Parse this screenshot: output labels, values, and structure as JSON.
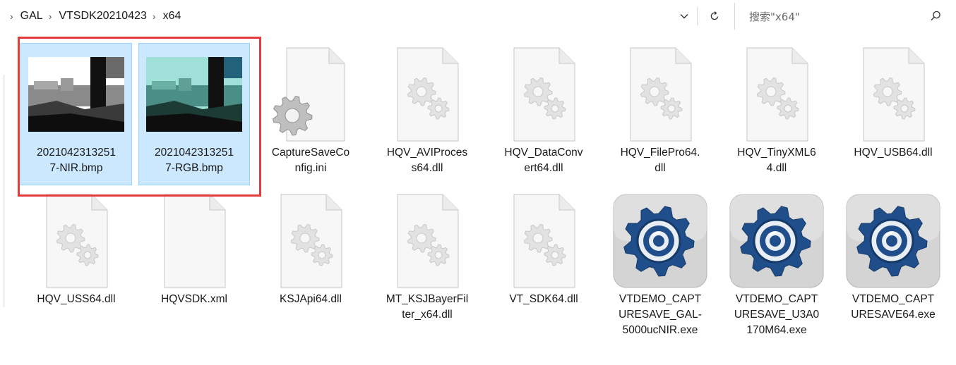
{
  "breadcrumb": {
    "items": [
      "GAL",
      "VTSDK20210423",
      "x64"
    ],
    "separator": "›"
  },
  "toolbar": {
    "dropdown_icon": "chevron-down-icon",
    "refresh_icon": "refresh-icon"
  },
  "search": {
    "placeholder": "搜索\"x64\"",
    "icon": "search-icon"
  },
  "files": [
    {
      "name": "20210423132517-NIR.bmp",
      "line1": "2021042313251",
      "line2": "7-NIR.bmp",
      "type": "bmp-nir",
      "selected": true
    },
    {
      "name": "20210423132517-RGB.bmp",
      "line1": "2021042313251",
      "line2": "7-RGB.bmp",
      "type": "bmp-rgb",
      "selected": true
    },
    {
      "name": "CaptureSaveConfig.ini",
      "line1": "CaptureSaveCo",
      "line2": "nfig.ini",
      "type": "ini"
    },
    {
      "name": "HQV_AVIProcess64.dll",
      "line1": "HQV_AVIProces",
      "line2": "s64.dll",
      "type": "dll"
    },
    {
      "name": "HQV_DataConvert64.dll",
      "line1": "HQV_DataConv",
      "line2": "ert64.dll",
      "type": "dll"
    },
    {
      "name": "HQV_FilePro64.dll",
      "line1": "HQV_FilePro64.",
      "line2": "dll",
      "type": "dll"
    },
    {
      "name": "HQV_TinyXML64.dll",
      "line1": "HQV_TinyXML6",
      "line2": "4.dll",
      "type": "dll"
    },
    {
      "name": "HQV_USB64.dll",
      "line1": "HQV_USB64.dll",
      "line2": "",
      "type": "dll"
    },
    {
      "name": "HQV_USS64.dll",
      "line1": "HQV_USS64.dll",
      "line2": "",
      "type": "dll"
    },
    {
      "name": "HQVSDK.xml",
      "line1": "HQVSDK.xml",
      "line2": "",
      "type": "xml"
    },
    {
      "name": "KSJApi64.dll",
      "line1": "KSJApi64.dll",
      "line2": "",
      "type": "dll"
    },
    {
      "name": "MT_KSJBayerFilter_x64.dll",
      "line1": "MT_KSJBayerFil",
      "line2": "ter_x64.dll",
      "type": "dll"
    },
    {
      "name": "VT_SDK64.dll",
      "line1": "VT_SDK64.dll",
      "line2": "",
      "type": "dll"
    },
    {
      "name": "VTDEMO_CAPTURESAVE_GAL-5000ucNIR.exe",
      "line1": "VTDEMO_CAPT",
      "line2": "URESAVE_GAL-",
      "line3": "5000ucNIR.exe",
      "type": "exe"
    },
    {
      "name": "VTDEMO_CAPTURESAVE_U3A0170M64.exe",
      "line1": "VTDEMO_CAPT",
      "line2": "URESAVE_U3A0",
      "line3": "170M64.exe",
      "type": "exe"
    },
    {
      "name": "VTDEMO_CAPTURESAVE64.exe",
      "line1": "VTDEMO_CAPT",
      "line2": "URESAVE64.exe",
      "type": "exe"
    }
  ],
  "colors": {
    "selection_bg": "#cce8ff",
    "selection_border": "#99d1ff",
    "highlight_frame": "#e63b3b",
    "exe_gear": "#1f4e8a"
  }
}
